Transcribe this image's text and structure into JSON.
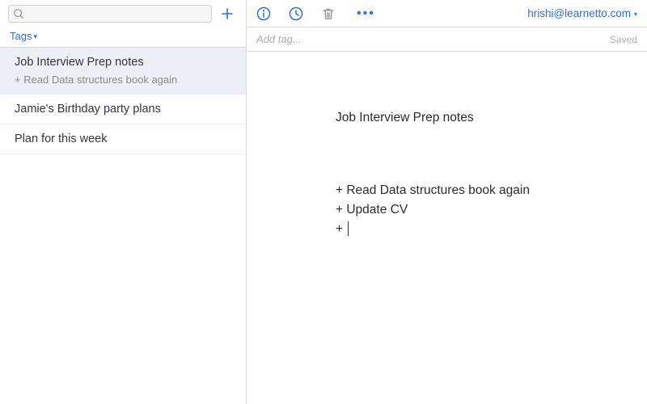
{
  "sidebar": {
    "search_placeholder": "",
    "tags_label": "Tags",
    "notes": [
      {
        "title": "Job Interview Prep notes",
        "preview": "+ Read Data structures book again",
        "selected": true
      },
      {
        "title": "Jamie's Birthday party plans",
        "preview": "",
        "selected": false
      },
      {
        "title": "Plan for this week",
        "preview": "",
        "selected": false
      }
    ]
  },
  "toolbar": {
    "account_email": "hrishi@learnetto.com"
  },
  "tagbar": {
    "placeholder": "Add tag...",
    "status": "Saved"
  },
  "editor": {
    "title": "Job Interview Prep notes",
    "body_line1": "+ Read Data structures book again",
    "body_line2": "+ Update CV",
    "body_line3": "+ "
  }
}
